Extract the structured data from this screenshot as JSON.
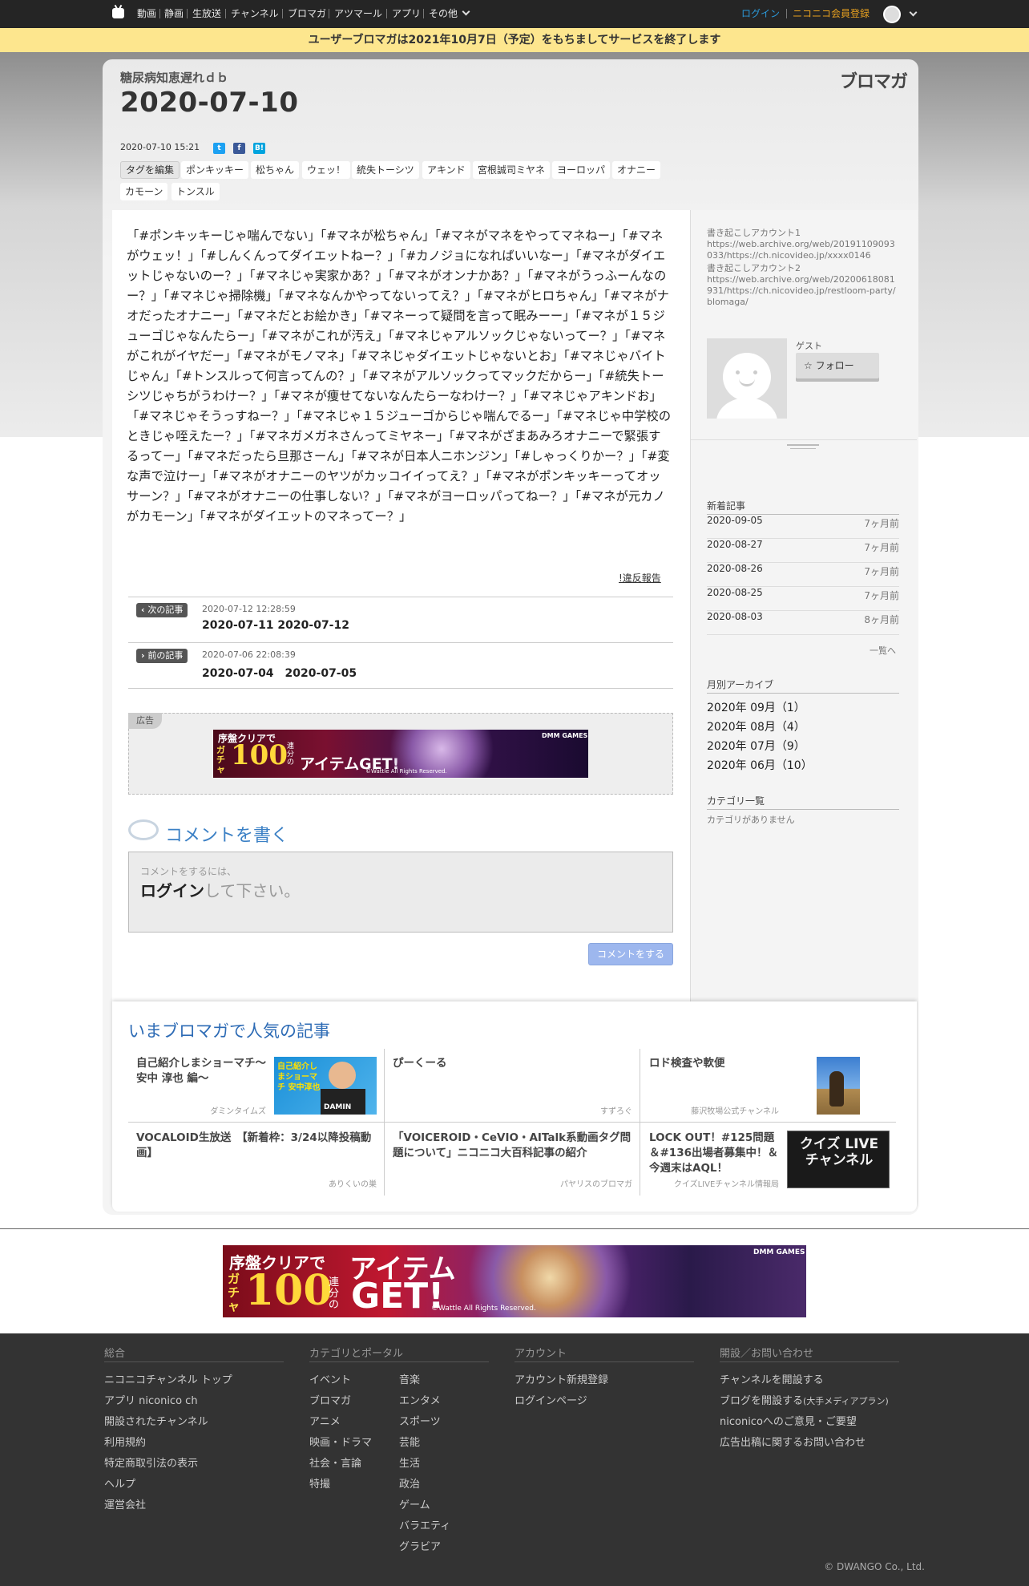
{
  "topnav": {
    "items": [
      "動画",
      "静画",
      "生放送",
      "チャンネル",
      "ブロマガ",
      "アツマール",
      "アプリ",
      "その他"
    ],
    "login": "ログイン",
    "register": "ニコニコ会員登録"
  },
  "notice": "ユーザーブロマガは2021年10月7日（予定）をもちましてサービスを終了します",
  "blog": {
    "owner": "糖尿病知恵遅れｄｂ",
    "logo": "ブロマガ",
    "title": "2020-07-10",
    "datetime": "2020-07-10 15:21",
    "tag_edit": "タグを編集",
    "tags": [
      "ポンキッキー",
      "松ちゃん",
      "ウェッ！",
      "統失トーシツ",
      "アキンド",
      "宮根誠司ミヤネ",
      "ヨーロッパ",
      "オナニー",
      "カモーン",
      "トンスル"
    ],
    "body": "「#ポンキッキーじゃ喘んでない」「#マネが松ちゃん」「#マネがマネをやってマネねー」「#マネがウェッ！」「#しんくんってダイエットねー？」「#カノジョになればいいなー」「#マネがダイエットじゃないのー？」「#マネじゃ実家かあ？」「#マネがオンナかあ？」「#マネがうっふーんなのー？」「#マネじゃ掃除機」「#マネなんかやってないってえ？」「#マネがヒロちゃん」「#マネがナオだったオナニー」「#マネだとお絵かき」「#マネーって疑問を言って眠みーー」「#マネが１５ジューゴじゃなんたらー」「#マネがこれが汚え」「#マネじゃアルソックじゃないってー？」「#マネがこれがイヤだー」「#マネがモノマネ」「#マネじゃダイエットじゃないとお」「#マネじゃバイトじゃん」「#トンスルって何言ってんの？」「#マネがアルソックってマックだからー」「#統失トーシツじゃちがうわけー？」「#マネが痩せてないなんたらーなわけー？」「#マネじゃアキンドお」「#マネじゃそうっすねー？」「#マネじゃ１５ジューゴからじゃ喘んでるー」「#マネじゃ中学校のときじゃ咥えたー？」「#マネガメガネさんってミヤネー」「#マネがざまあみろオナニーで緊張するってー」「#マネだったら旦那さーん」「#マネが日本人ニホンジン」「#しゃっくりかー？」「#変な声で泣けー」「#マネがオナニーのヤツがカッコイイってえ？」「#マネがポンキッキーってオッサーン？」「#マネがオナニーの仕事しない？」「#マネがヨーロッパってねー？」「#マネが元カノがカモーン」「#マネがダイエットのマネってー？」",
    "report": "!違反報告",
    "next": {
      "badge": "次の記事",
      "meta": "2020-07-12 12:28:59",
      "title": "2020-07-11 2020-07-12"
    },
    "prev": {
      "badge": "前の記事",
      "meta": "2020-07-06 22:08:39",
      "title": "2020-07-04　2020-07-05"
    },
    "ad_label": "広告"
  },
  "comment": {
    "heading": "コメントを書く",
    "hint": "コメントをするには、",
    "login_word": "ログイン",
    "login_rest": "して下さい。",
    "button": "コメントをする"
  },
  "banner_small": {
    "line1": "序盤クリアで",
    "gacha": "ガチャ",
    "num": "100",
    "unit": "連分の",
    "get": "アイテムGET!",
    "copy": "©Wattle All Rights Reserved.",
    "brand": "DMM GAMES"
  },
  "banner_large": {
    "line1": "序盤クリアで",
    "gacha": "ガチャ",
    "num": "100",
    "unit": "連分の",
    "item": "アイテム",
    "get": "GET!",
    "copy": "©Wattle All Rights Reserved.",
    "brand": "DMM GAMES"
  },
  "sidebar": {
    "accounts": [
      {
        "label": "書き起こしアカウント1",
        "url": "https://web.archive.org/web/20191109093033/https://ch.nicovideo.jp/xxxx0146"
      },
      {
        "label": "書き起こしアカウント2",
        "url": "https://web.archive.org/web/20200618081931/https://ch.nicovideo.jp/restloom-party/blomaga/"
      }
    ],
    "guest": "ゲスト",
    "follow": "フォロー",
    "new_heading": "新着記事",
    "new_posts": [
      {
        "date": "2020-09-05",
        "ago": "7ヶ月前"
      },
      {
        "date": "2020-08-27",
        "ago": "7ヶ月前"
      },
      {
        "date": "2020-08-26",
        "ago": "7ヶ月前"
      },
      {
        "date": "2020-08-25",
        "ago": "7ヶ月前"
      },
      {
        "date": "2020-08-03",
        "ago": "8ヶ月前"
      }
    ],
    "more": "一覧へ",
    "archive_heading": "月別アーカイブ",
    "archives": [
      "2020年 09月（1）",
      "2020年 08月（4）",
      "2020年 07月（9）",
      "2020年 06月（10）"
    ],
    "category_heading": "カテゴリ一覧",
    "category_empty": "カテゴリがありません"
  },
  "popular": {
    "heading": "いまブロマガで人気の記事",
    "items": [
      {
        "title": "自己紹介しまショーマチ〜安中 淳也 編〜",
        "source": "ダミンタイムズ",
        "thumb_text": "自己紹介しまショーマチ 安中淳也",
        "thumb_shirt": "DAMIN"
      },
      {
        "title": "ぴーくーる",
        "source": "すずろぐ"
      },
      {
        "title": "ロド検査や軟便",
        "source": "藤沢牧場公式チャンネル"
      },
      {
        "title": "VOCALOID生放送　【新着枠：3/24以降投稿動画】",
        "source": "ありくいの巣"
      },
      {
        "title": "「VOICEROID・CeVIO・AITalk系動画タグ問題について」ニコニコ大百科記事の紹介",
        "source": "パヤリスのブロマガ"
      },
      {
        "title": "LOCK OUT！#125問題＆#136出場者募集中！＆今週末はAQL！",
        "source": "クイズLIVEチャンネル情報局",
        "thumb_text": "クイズ LIVE チャンネル"
      }
    ]
  },
  "footer": {
    "col1": {
      "heading": "総合",
      "links": [
        "ニコニコチャンネル トップ",
        "アプリ niconico ch",
        "開設されたチャンネル",
        "利用規約",
        "特定商取引法の表示",
        "ヘルプ",
        "運営会社"
      ]
    },
    "col2": {
      "heading": "カテゴリとポータル",
      "left": [
        "イベント",
        "ブロマガ",
        "アニメ",
        "映画・ドラマ",
        "社会・言論",
        "特撮"
      ],
      "right": [
        "音楽",
        "エンタメ",
        "スポーツ",
        "芸能",
        "生活",
        "政治",
        "ゲーム",
        "バラエティ",
        "グラビア"
      ]
    },
    "col3": {
      "heading": "アカウント",
      "links": [
        "アカウント新規登録",
        "ログインページ"
      ]
    },
    "col4": {
      "heading": "開設／お問い合わせ",
      "links": [
        "チャンネルを開設する",
        "ブログを開設する",
        "niconicoへのご意見・ご要望",
        "広告出稿に関するお問い合わせ"
      ],
      "small": "(大手メディアプラン)"
    },
    "copyright": "© DWANGO Co., Ltd."
  }
}
